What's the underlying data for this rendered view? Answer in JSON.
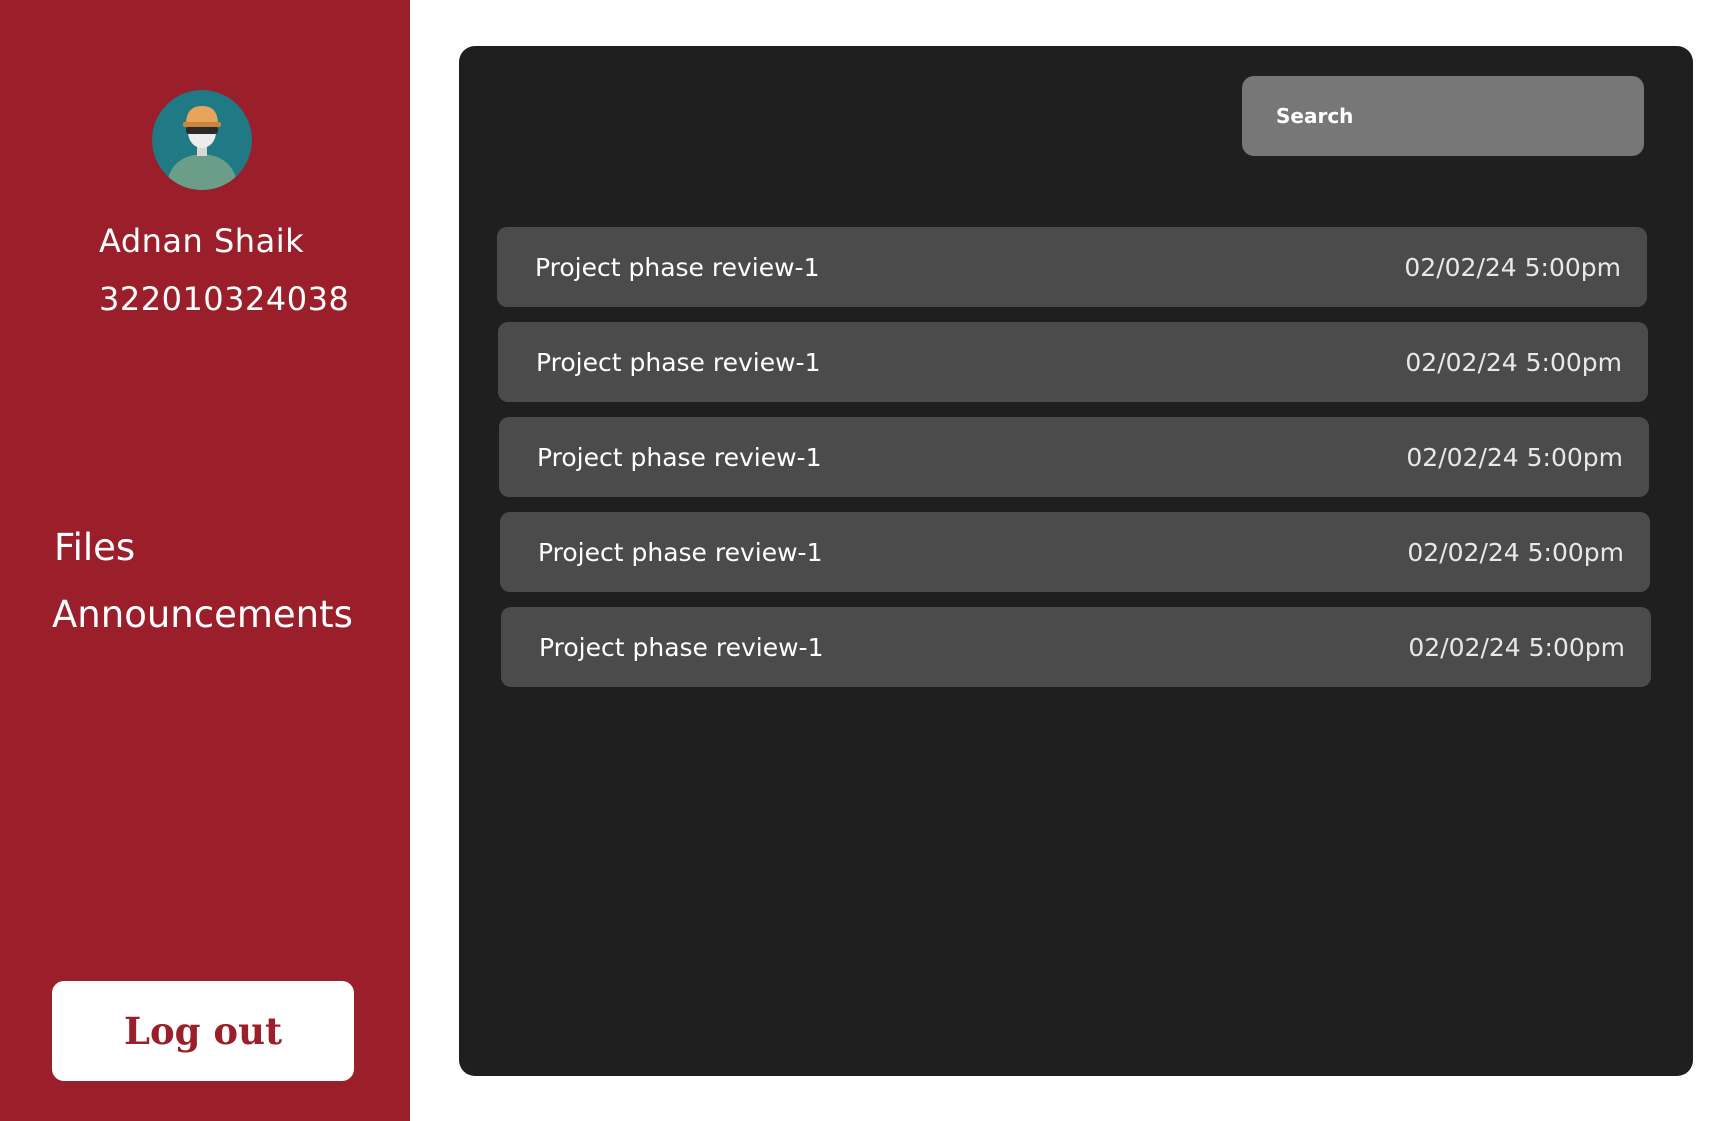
{
  "profile": {
    "name": "Adnan Shaik",
    "id": "322010324038",
    "avatar_icon": "user-avatar-icon"
  },
  "nav": {
    "files": "Files",
    "announcements": "Announcements"
  },
  "logout_label": "Log out",
  "search": {
    "placeholder": "Search"
  },
  "items": [
    {
      "title": "Project phase review-1",
      "date": "02/02/24 5:00pm"
    },
    {
      "title": "Project phase review-1",
      "date": "02/02/24 5:00pm"
    },
    {
      "title": "Project phase review-1",
      "date": "02/02/24 5:00pm"
    },
    {
      "title": "Project phase review-1",
      "date": "02/02/24 5:00pm"
    },
    {
      "title": "Project phase review-1",
      "date": "02/02/24 5:00pm"
    }
  ],
  "colors": {
    "sidebar": "#9b1f2b",
    "panel": "#1f1f1f",
    "row": "#4b4b4b",
    "search": "#777777"
  }
}
